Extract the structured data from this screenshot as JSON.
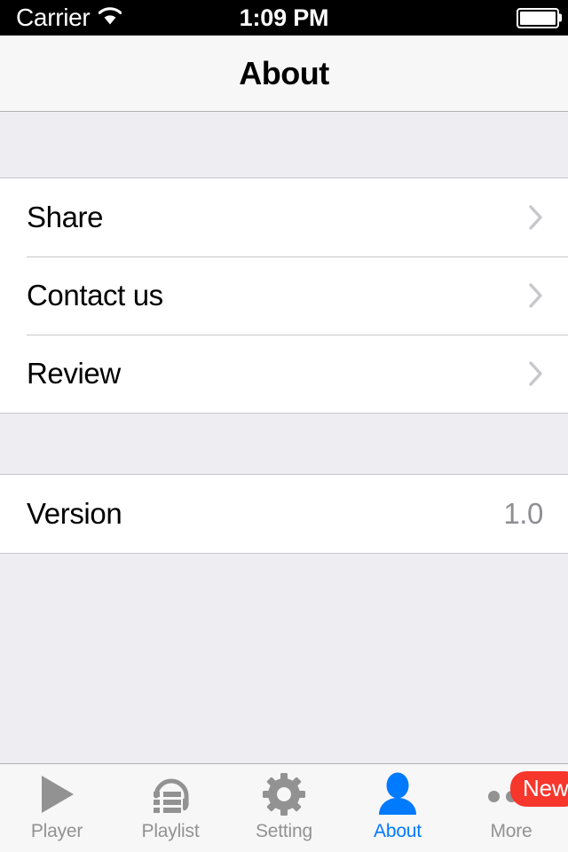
{
  "status_bar": {
    "carrier": "Carrier",
    "wifi_icon": "wifi-icon",
    "time": "1:09 PM",
    "battery_icon": "battery-full-icon"
  },
  "nav_bar": {
    "title": "About"
  },
  "list": {
    "sections": [
      {
        "rows": [
          {
            "label": "Share",
            "accessory": "chevron-right-icon",
            "value": ""
          },
          {
            "label": "Contact us",
            "accessory": "chevron-right-icon",
            "value": ""
          },
          {
            "label": "Review",
            "accessory": "chevron-right-icon",
            "value": ""
          }
        ]
      },
      {
        "rows": [
          {
            "label": "Version",
            "accessory": "none",
            "value": "1.0"
          }
        ]
      }
    ]
  },
  "tab_bar": {
    "items": [
      {
        "label": "Player",
        "icon": "play-triangle-icon",
        "active": false,
        "badge": ""
      },
      {
        "label": "Playlist",
        "icon": "headphones-list-icon",
        "active": false,
        "badge": ""
      },
      {
        "label": "Setting",
        "icon": "gear-icon",
        "active": false,
        "badge": ""
      },
      {
        "label": "About",
        "icon": "person-icon",
        "active": true,
        "badge": ""
      },
      {
        "label": "More",
        "icon": "ellipsis-icon",
        "active": false,
        "badge": "New"
      }
    ]
  },
  "colors": {
    "accent_blue": "#007aff",
    "badge_red": "#f7362c",
    "inactive_gray": "#929292",
    "value_gray": "#8e8e93",
    "group_background": "#eeeef2",
    "bar_background": "#f7f7f7"
  }
}
